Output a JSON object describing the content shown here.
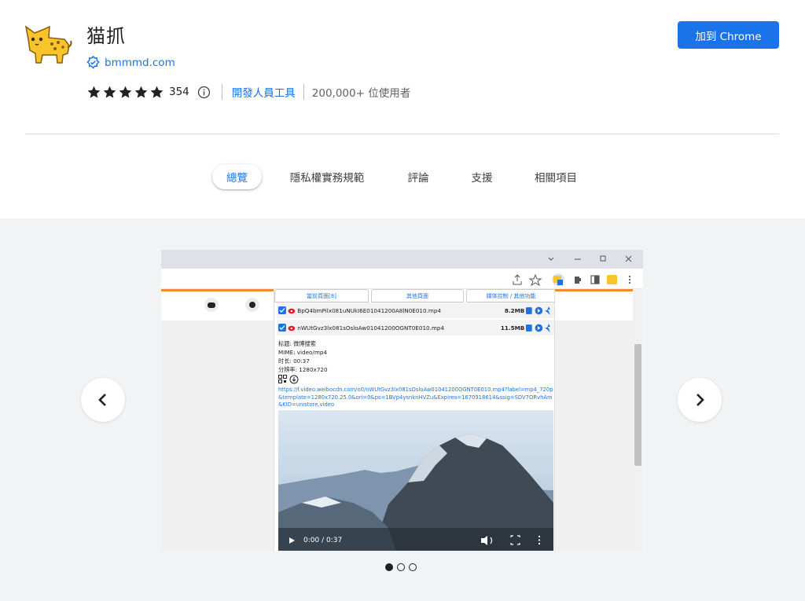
{
  "header": {
    "title": "猫抓",
    "site": "bmmmd.com",
    "rating_count": "354",
    "category": "開發人員工具",
    "users": "200,000+ 位使用者",
    "add_button": "加到 Chrome"
  },
  "colors": {
    "accent": "#1a73e8",
    "gallery_bg": "#f1f3f4",
    "divider": "#dadce0"
  },
  "tabs": [
    {
      "label": "總覽",
      "active": true
    },
    {
      "label": "隱私權實務規範",
      "active": false
    },
    {
      "label": "評論",
      "active": false
    },
    {
      "label": "支援",
      "active": false
    },
    {
      "label": "相關項目",
      "active": false
    }
  ],
  "gallery": {
    "prev_icon": "chevron-left-icon",
    "next_icon": "chevron-right-icon",
    "dots_count": 3,
    "active_dot": 0
  },
  "screenshot": {
    "popup_tabs": [
      "當前頁面[8]",
      "其他頁面",
      "媒体控制 / 其他功能"
    ],
    "rows": [
      {
        "name": "BpQ4bmPilx081uNUkI6E01041200A8lN0E010.mp4",
        "size": "8.2MB"
      },
      {
        "name": "nWUtGvz3lx081sOsloAw01041200OGNT0E010.mp4",
        "size": "11.5MB"
      }
    ],
    "info": {
      "title_line": "标题: 微博搜索",
      "mime_line": "MIME: video/mp4",
      "duration_line": "时长: 00:37",
      "resolution_line": "分辨率: 1280x720"
    },
    "link": "https://f.video.weibocdn.com/o0/nWUtGvz3lx081sOsloAw01041200OGNT0E010.mp4?label=mp4_720p&template=1280x720.25.0&ori=0&ps=1BVp4ysnknHVZu&Expires=1670918614&ssig=SDV7ORvhAm&KID=unistore,video",
    "video_time": "0:00 / 0:37"
  }
}
